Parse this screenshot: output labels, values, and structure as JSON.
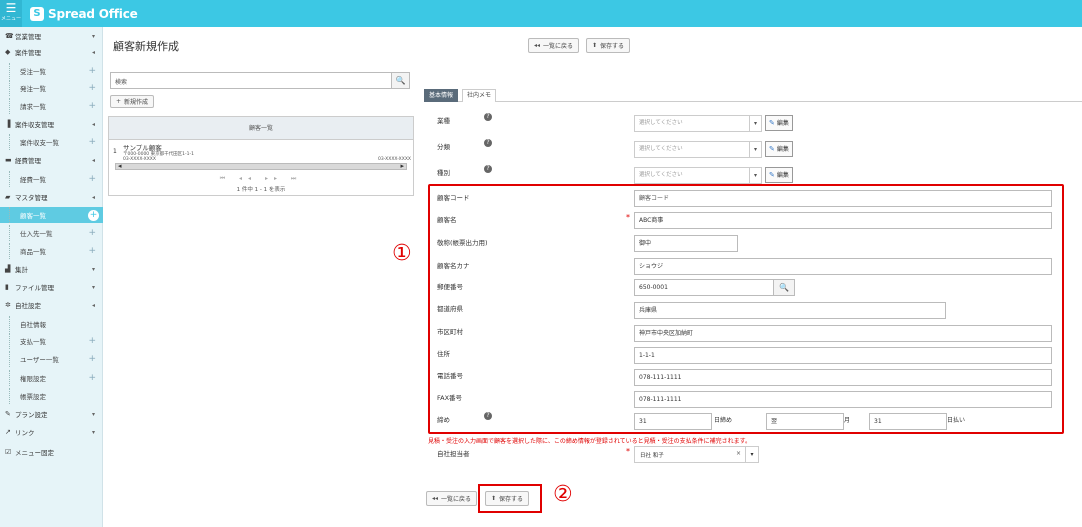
{
  "app": {
    "menu_label": "メニュー",
    "logo_text": "Spread Office",
    "logo_mark": "S"
  },
  "sidebar": {
    "items": [
      {
        "label": "営業管理",
        "type": "sec",
        "icon": "☎",
        "marker": "▾"
      },
      {
        "label": "案件管理",
        "type": "sec",
        "icon": "◆",
        "marker": "◂"
      },
      {
        "label": "受注一覧",
        "type": "sub",
        "marker": "+"
      },
      {
        "label": "発注一覧",
        "type": "sub",
        "marker": "+"
      },
      {
        "label": "請求一覧",
        "type": "sub",
        "marker": "+"
      },
      {
        "label": "案件収支管理",
        "type": "sec",
        "icon": "▐",
        "marker": "◂"
      },
      {
        "label": "案件収支一覧",
        "type": "sub",
        "marker": "+"
      },
      {
        "label": "経費管理",
        "type": "sec",
        "icon": "▬",
        "marker": "◂"
      },
      {
        "label": "経費一覧",
        "type": "sub",
        "marker": "+"
      },
      {
        "label": "マスタ管理",
        "type": "sec",
        "icon": "▰",
        "marker": "◂"
      },
      {
        "label": "顧客一覧",
        "type": "sub",
        "marker": "+",
        "active": true
      },
      {
        "label": "仕入先一覧",
        "type": "sub",
        "marker": "+"
      },
      {
        "label": "商品一覧",
        "type": "sub",
        "marker": "+"
      },
      {
        "label": "集計",
        "type": "sec",
        "icon": "▟",
        "marker": "▾"
      },
      {
        "label": "ファイル管理",
        "type": "sec",
        "icon": "▮",
        "marker": "▾"
      },
      {
        "label": "自社設定",
        "type": "sec",
        "icon": "✲",
        "marker": "◂"
      },
      {
        "label": "自社情報",
        "type": "sub",
        "marker": ""
      },
      {
        "label": "支払一覧",
        "type": "sub",
        "marker": "+"
      },
      {
        "label": "ユーザー一覧",
        "type": "sub",
        "marker": "+"
      },
      {
        "label": "権限設定",
        "type": "sub",
        "marker": "+"
      },
      {
        "label": "帳票設定",
        "type": "sub",
        "marker": ""
      },
      {
        "label": "プラン設定",
        "type": "sec",
        "icon": "✎",
        "marker": "▾"
      },
      {
        "label": "リンク",
        "type": "sec",
        "icon": "↗",
        "marker": "▾"
      },
      {
        "label": "メニュー固定",
        "type": "sec",
        "icon": "☑",
        "marker": ""
      }
    ]
  },
  "page": {
    "title": "顧客新規作成"
  },
  "toolbar": {
    "back_label": "一覧に戻る",
    "save_label": "保存する",
    "back_icon": "◂◂",
    "save_icon": "⬆"
  },
  "search": {
    "placeholder": "検索",
    "icon": "🔍"
  },
  "left": {
    "new_button": "新規作成",
    "grid_header": "顧客一覧",
    "row": {
      "no": "1",
      "name": "サンプル顧客",
      "address": "〒000-0000 東京都千代田区1-1-1",
      "tel_left": "03-XXXX-XXXX",
      "tel_right": "03-XXXX-XXXX"
    },
    "pager_symbols": "⏮ ◂◂ ▸▸ ⏭",
    "pager_info": "1 件中 1 - 1 を表示"
  },
  "tabs": [
    {
      "label": "基本情報",
      "active": true
    },
    {
      "label": "社内メモ",
      "active": false
    }
  ],
  "top_fields": {
    "select_placeholder": "選択してください",
    "edit_label": "編集",
    "labels": [
      "業種",
      "分類",
      "種別"
    ]
  },
  "form": {
    "customer_code": {
      "label": "顧客コード",
      "value": "顧客コード"
    },
    "customer_name": {
      "label": "顧客名",
      "value": "ABC商事"
    },
    "honorific": {
      "label": "敬称(帳票出力用)",
      "value": "御中"
    },
    "kana": {
      "label": "顧客名カナ",
      "value": "ショウジ"
    },
    "postal": {
      "label": "郵便番号",
      "value": "650-0001"
    },
    "prefecture": {
      "label": "都道府県",
      "value": "兵庫県"
    },
    "city": {
      "label": "市区町村",
      "value": "神戸市中央区加納町"
    },
    "address": {
      "label": "住所",
      "value": "1-1-1"
    },
    "phone": {
      "label": "電話番号",
      "value": "078-111-1111"
    },
    "fax": {
      "label": "FAX番号",
      "value": "078-111-1111"
    },
    "closing": {
      "label": "締め",
      "closing_day": "31",
      "closing_day_unit": "日締め",
      "pay_month": "翌",
      "pay_month_unit": "月",
      "pay_day": "31",
      "pay_day_unit": "日払い"
    },
    "notice": "見積・受注の入力画面で顧客を選択した際に、この締め情報が登録されていると見積・受注の支払条件に補完されます。",
    "rep": {
      "label": "自社担当者",
      "value": "日社 和子"
    }
  },
  "annotations": {
    "marker_1": "①",
    "marker_2": "②"
  }
}
